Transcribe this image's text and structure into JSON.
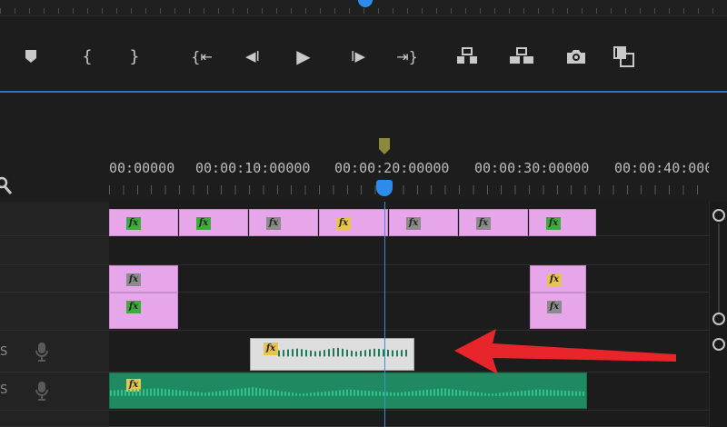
{
  "colors": {
    "accent": "#2d8ceb",
    "video_clip": "#e7a6e9",
    "audio_clip": "#1f8a62",
    "fx_green": "#3fab3f",
    "fx_gray": "#8b8b8b",
    "fx_yellow": "#e7c34f",
    "annotation_arrow": "#e8252a"
  },
  "toolbar": {
    "buttons": [
      {
        "name": "add-marker-button",
        "icon": "marker-icon"
      },
      {
        "name": "mark-in-button",
        "icon": "mark-in-icon",
        "glyph": "{"
      },
      {
        "name": "mark-out-button",
        "icon": "mark-out-icon",
        "glyph": "}"
      },
      {
        "name": "go-to-in-button",
        "icon": "go-to-in-icon",
        "glyph": "{⇤"
      },
      {
        "name": "step-back-button",
        "icon": "step-back-icon",
        "glyph": "◀I"
      },
      {
        "name": "play-button",
        "icon": "play-icon",
        "glyph": "▶"
      },
      {
        "name": "step-forward-button",
        "icon": "step-forward-icon",
        "glyph": "I▶"
      },
      {
        "name": "go-to-out-button",
        "icon": "go-to-out-icon",
        "glyph": "⇥}"
      },
      {
        "name": "lift-button",
        "icon": "lift-icon"
      },
      {
        "name": "extract-button",
        "icon": "extract-icon"
      },
      {
        "name": "export-frame-button",
        "icon": "camera-icon"
      },
      {
        "name": "comparison-view-button",
        "icon": "comparison-view-icon"
      }
    ]
  },
  "ruler": {
    "timecodes": [
      "00:00000",
      "00:00:10:00000",
      "00:00:20:00000",
      "00:00:30:00000",
      "00:00:40:00000"
    ]
  },
  "tracks": {
    "audio_labels": [
      "S",
      "S"
    ],
    "fx_label": "fx",
    "video_row1": [
      {
        "fx": "green"
      },
      {
        "fx": "green"
      },
      {
        "fx": "gray"
      },
      {
        "fx": "yellow"
      },
      {
        "fx": "gray"
      },
      {
        "fx": "gray"
      },
      {
        "fx": "green"
      }
    ],
    "video_row2": [
      {
        "fx": "gray"
      },
      {
        "fx": "yellow"
      }
    ],
    "video_row3": [
      {
        "fx": "green"
      },
      {
        "fx": "gray"
      }
    ]
  }
}
